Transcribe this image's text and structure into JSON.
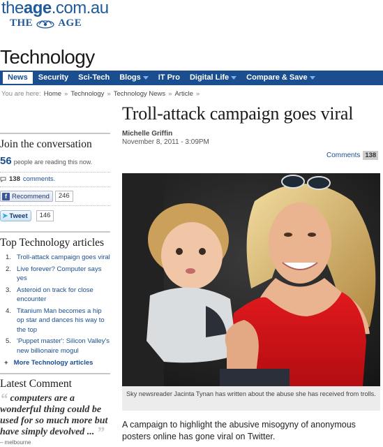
{
  "masthead": {
    "url_prefix": "the",
    "url_bold": "age",
    "url_suffix": ".com.au",
    "logo_left": "THE",
    "logo_right": "AGE"
  },
  "section": {
    "title": "Technology"
  },
  "nav": {
    "items": [
      {
        "label": "News",
        "active": true,
        "dropdown": false
      },
      {
        "label": "Security",
        "active": false,
        "dropdown": false
      },
      {
        "label": "Sci-Tech",
        "active": false,
        "dropdown": false
      },
      {
        "label": "Blogs",
        "active": false,
        "dropdown": true
      },
      {
        "label": "IT Pro",
        "active": false,
        "dropdown": false
      },
      {
        "label": "Digital Life",
        "active": false,
        "dropdown": true
      },
      {
        "label": "Compare & Save",
        "active": false,
        "dropdown": true
      }
    ]
  },
  "breadcrumb": {
    "prefix": "You are here:",
    "items": [
      "Home",
      "Technology",
      "Technology News",
      "Article"
    ],
    "separator": "»"
  },
  "sidebar": {
    "conversation_heading": "Join the conversation",
    "readers_count": "56",
    "readers_text": "people are reading this now.",
    "comments_count": "138",
    "comments_label": "comments.",
    "recommend_label": "Recommend",
    "recommend_count": "246",
    "tweet_label": "Tweet",
    "tweet_count": "146",
    "top_heading": "Top Technology articles",
    "top_articles": [
      "Troll-attack campaign goes viral",
      "Live forever? Computer says yes",
      "Asteroid on track for close encounter",
      "Titanium Man becomes a hip op star and dances his way to the top",
      "'Puppet master': Silicon Valley's new billionaire mogul"
    ],
    "more_label": "More Technology articles",
    "latest_heading": "Latest Comment",
    "latest_quote": "computers are a wonderful thing could be used for so much more but have simply devolved ...",
    "latest_by": "– melbourne"
  },
  "article": {
    "headline": "Troll-attack campaign goes viral",
    "author": "Michelle Griffin",
    "date": "November 8, 2011 - 3:09PM",
    "comments_label": "Comments",
    "comments_count": "138",
    "caption": "Sky newsreader Jacinta Tynan has written about the abuse she has received from trolls.",
    "lede": "A campaign to highlight the abusive misogyny of anonymous posters online has gone viral on Twitter."
  },
  "colors": {
    "brand_blue": "#1a4e8f",
    "nav_bg": "#1a4e8f",
    "link": "#1a4e8f"
  }
}
